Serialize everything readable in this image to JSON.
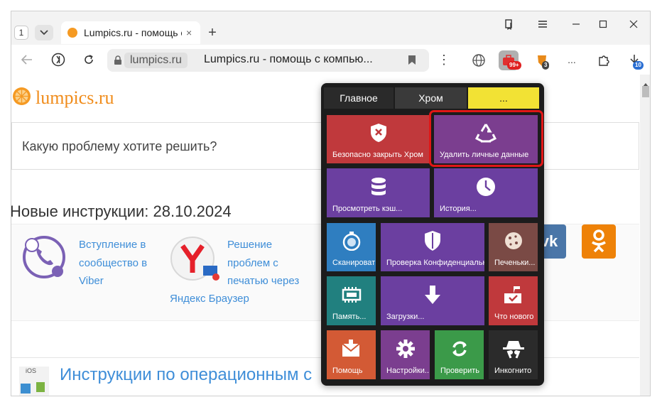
{
  "tabbar": {
    "tab_count": "1",
    "tab_title": "Lumpics.ru - помощь с",
    "tab_close": "×",
    "new_tab": "+"
  },
  "toolbar": {
    "site_chip": "lumpics.ru",
    "page_title": "Lumpics.ru - помощь с компью...",
    "more": "⋮",
    "ext_badge_99": "99+",
    "ext_badge_3": "3",
    "ext_more": "...",
    "downloads_badge": "10"
  },
  "page": {
    "logo": "lumpics.ru",
    "search_placeholder": "Какую проблему хотите решить?",
    "section_title": "Новые инструкции: 28.10.2024",
    "card1_line1": "Вступление в",
    "card1_line2": "сообщество в",
    "card1_line3": "Viber",
    "card2_line1": "Решение",
    "card2_line2": "проблем с",
    "card2_line3": "печатью через",
    "card2_line4": "Яндекс Браузер",
    "vk": "vk",
    "os_section_title": "Инструкции по операционным с",
    "os_icon_label": "iOS"
  },
  "popup": {
    "tabs": [
      "Главное",
      "Хром",
      "..."
    ],
    "tiles": {
      "close_chrome": "Безопасно закрыть Хром",
      "delete_personal": "Удалить личные данные",
      "view_cache": "Просмотреть кэш...",
      "history": "История...",
      "scan": "Сканировать",
      "privacy_check": "Проверка Конфиденциальности",
      "cookies": "Печеньки...",
      "memory": "Память...",
      "downloads": "Загрузки...",
      "whats_new": "Что нового",
      "help": "Помощь",
      "settings": "Настройки...",
      "check": "Проверить",
      "incognito": "Инкогнито"
    }
  },
  "colors": {
    "red_tile": "#c0393c",
    "purple_tile": "#7b3e8f",
    "violet_tile": "#6b3fa0",
    "blue_tile": "#2f7ec0",
    "teal_tile": "#21807f",
    "green_tile": "#3b9a49",
    "orange_tile": "#d35a35",
    "brown_tile": "#7a4a45",
    "yellow_tab": "#f2e234",
    "highlight": "#e11616",
    "vk": "#4a76a8",
    "ok": "#ee8208"
  }
}
